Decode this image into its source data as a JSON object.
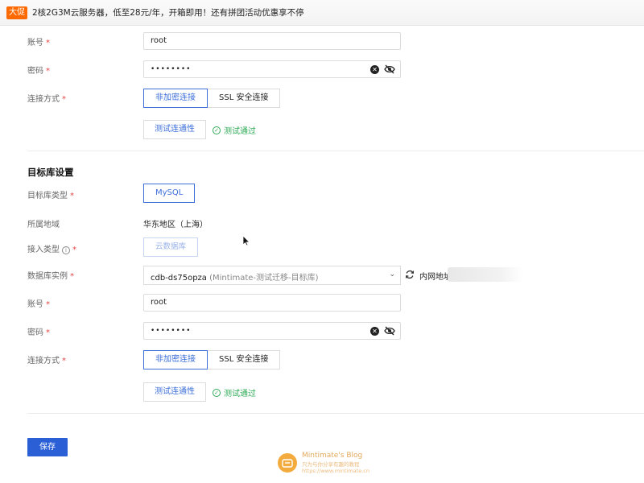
{
  "banner": {
    "tag": "大促",
    "text": "2核2G3M云服务器，低至28元/年，开箱即用！还有拼团活动优惠享不停"
  },
  "source": {
    "account_label": "账号",
    "account_value": "root",
    "password_label": "密码",
    "password_value": "••••••••",
    "conn_label": "连接方式",
    "conn_options": [
      "非加密连接",
      "SSL 安全连接"
    ],
    "test_button": "测试连通性",
    "test_status": "测试通过"
  },
  "target": {
    "section_title": "目标库设置",
    "db_type_label": "目标库类型",
    "db_type_value": "MySQL",
    "region_label": "所属地域",
    "region_value": "华东地区（上海）",
    "access_label": "接入类型",
    "access_value": "云数据库",
    "instance_label": "数据库实例",
    "instance_main": "cdb-ds75opza",
    "instance_sub": "(Mintimate-测试迁移-目标库)",
    "net_label": "内网地址",
    "account_label": "账号",
    "account_value": "root",
    "password_label": "密码",
    "password_value": "••••••••",
    "conn_label": "连接方式",
    "conn_options": [
      "非加密连接",
      "SSL 安全连接"
    ],
    "test_button": "测试连通性",
    "test_status": "测试通过"
  },
  "footer": {
    "save_button": "保存",
    "watermark_title": "Mintimate's Blog",
    "watermark_sub": "只为与你分享有趣的教程",
    "watermark_url": "https://www.mintimate.cn"
  },
  "required_mark": "*",
  "colors": {
    "accent": "#3d6fd9",
    "primary_button": "#2a5fd6",
    "success": "#2faa56",
    "required": "#e54545",
    "banner_tag": "#ff6a00"
  },
  "icons": {
    "clear": "clear-icon",
    "eye": "eye-off-icon",
    "check": "check-circle-icon",
    "info": "info-icon",
    "refresh": "refresh-icon",
    "chevron": "chevron-down-icon"
  }
}
